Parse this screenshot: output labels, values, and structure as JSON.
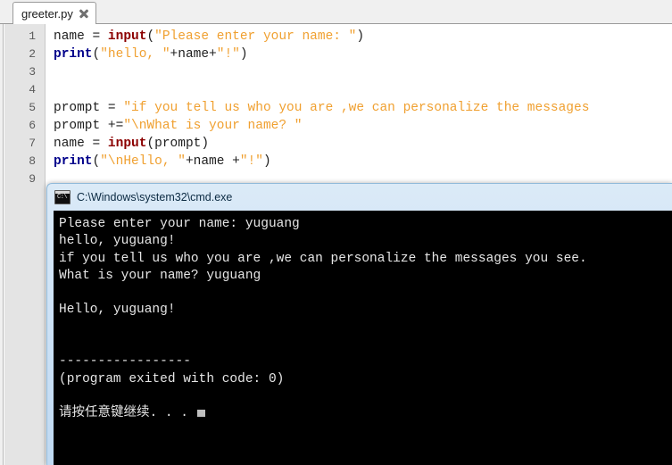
{
  "editor": {
    "tab": {
      "label": "greeter.py",
      "close_icon": "close-icon"
    },
    "gutter_lines": [
      "1",
      "2",
      "3",
      "4",
      "5",
      "6",
      "7",
      "8",
      "9"
    ],
    "code": [
      [
        {
          "t": "name = ",
          "c": "plain"
        },
        {
          "t": "input",
          "c": "fn"
        },
        {
          "t": "(",
          "c": "punct"
        },
        {
          "t": "\"Please enter your name: \"",
          "c": "str"
        },
        {
          "t": ")",
          "c": "punct"
        }
      ],
      [
        {
          "t": "print",
          "c": "kw"
        },
        {
          "t": "(",
          "c": "punct"
        },
        {
          "t": "\"hello, \"",
          "c": "str"
        },
        {
          "t": "+name+",
          "c": "plain"
        },
        {
          "t": "\"!\"",
          "c": "str"
        },
        {
          "t": ")",
          "c": "punct"
        }
      ],
      [],
      [],
      [
        {
          "t": "prompt = ",
          "c": "plain"
        },
        {
          "t": "\"if you tell us who you are ,we can personalize the messages",
          "c": "str"
        }
      ],
      [
        {
          "t": "prompt +=",
          "c": "plain"
        },
        {
          "t": "\"\\nWhat is your name? \"",
          "c": "str"
        }
      ],
      [
        {
          "t": "name = ",
          "c": "plain"
        },
        {
          "t": "input",
          "c": "fn"
        },
        {
          "t": "(prompt)",
          "c": "punct"
        }
      ],
      [
        {
          "t": "print",
          "c": "kw"
        },
        {
          "t": "(",
          "c": "punct"
        },
        {
          "t": "\"\\nHello, \"",
          "c": "str"
        },
        {
          "t": "+name +",
          "c": "plain"
        },
        {
          "t": "\"!\"",
          "c": "str"
        },
        {
          "t": ")",
          "c": "punct"
        }
      ],
      []
    ]
  },
  "console": {
    "icon": "cmd-icon",
    "icon_glyph": "C:\\",
    "title": "C:\\Windows\\system32\\cmd.exe",
    "lines": [
      "Please enter your name: yuguang",
      "hello, yuguang!",
      "if you tell us who you are ,we can personalize the messages you see.",
      "What is your name? yuguang",
      "",
      "Hello, yuguang!",
      "",
      "",
      "-----------------",
      "(program exited with code: 0)",
      "",
      "请按任意键继续. . ."
    ],
    "cursor_line_index": 11
  },
  "colors": {
    "keyword": "#00008b",
    "function": "#8b0000",
    "string": "#f0a030",
    "console_bg": "#000000",
    "console_fg": "#e6e6e6",
    "titlebar": "#cfe3f6"
  }
}
